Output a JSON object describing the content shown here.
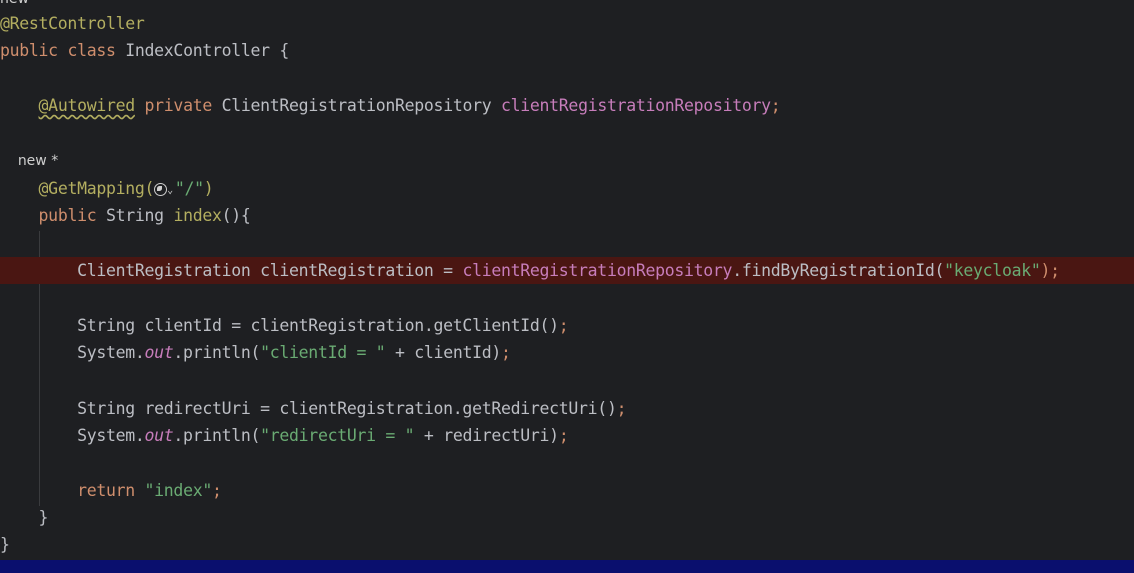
{
  "hints": {
    "top_partial": "new",
    "method_hint": "new *"
  },
  "code": {
    "l1_ann": "@RestController",
    "l2_public": "public",
    "l2_class": "class",
    "l2_rest": "IndexController {",
    "l4_ann": "@Autowired",
    "l4_private": "private",
    "l4_type": "ClientRegistrationRepository",
    "l4_field": "clientRegistrationRepository",
    "l4_semi": ";",
    "l7_ann": "@GetMapping(",
    "l7_str": "\"/\"",
    "l7_close": ")",
    "l8_public": "public",
    "l8_type": "String",
    "l8_method": "index",
    "l8_rest": "(){",
    "l10_decl": "ClientRegistration clientRegistration = ",
    "l10_field": "clientRegistrationRepository",
    "l10_call": ".findByRegistrationId(",
    "l10_str": "\"keycloak\"",
    "l10_end": ");",
    "l12_decl": "String clientId = clientRegistration.getClientId()",
    "l12_semi": ";",
    "l13_sys": "System.",
    "l13_out": "out",
    "l13_call": ".println(",
    "l13_str": "\"clientId = \"",
    "l13_rest": " + clientId)",
    "l13_semi": ";",
    "l15_decl": "String redirectUri = clientRegistration.getRedirectUri()",
    "l15_semi": ";",
    "l16_sys": "System.",
    "l16_out": "out",
    "l16_call": ".println(",
    "l16_str": "\"redirectUri = \"",
    "l16_rest": " + redirectUri)",
    "l16_semi": ";",
    "l18_return": "return",
    "l18_str": "\"index\"",
    "l18_semi": ";",
    "l19_brace": "}",
    "l20_brace": "}"
  },
  "icons": {
    "globe": "globe-icon",
    "chevron": "chevron-down-icon"
  },
  "colors": {
    "background": "#1e1f22",
    "annotation": "#b3ae60",
    "keyword": "#cf8e6d",
    "field": "#c77dbb",
    "string": "#6aab73",
    "error_line": "#4a1612",
    "status_strip": "#0a0f6e"
  }
}
